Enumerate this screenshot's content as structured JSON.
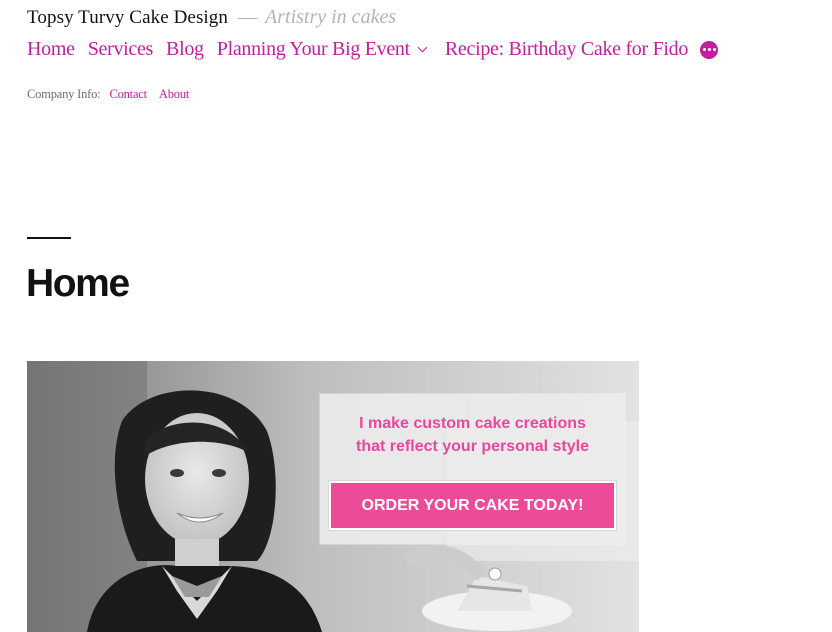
{
  "site": {
    "title": "Topsy Turvy Cake Design",
    "tagline_separator": "—",
    "tagline": "Artistry in cakes"
  },
  "main_nav": {
    "items": [
      {
        "label": "Home"
      },
      {
        "label": "Services"
      },
      {
        "label": "Blog"
      },
      {
        "label": "Planning Your Big Event",
        "has_submenu": true
      },
      {
        "label": "Recipe: Birthday Cake for Fido"
      }
    ],
    "more_icon": "more-dots-icon"
  },
  "secondary_nav": {
    "label": "Company Info:",
    "links": [
      {
        "label": "Contact"
      },
      {
        "label": "About"
      }
    ]
  },
  "page": {
    "title": "Home"
  },
  "hero": {
    "line1": "I make custom cake creations",
    "line2": "that reflect your personal style",
    "button_label": "ORDER YOUR CAKE TODAY!"
  },
  "colors": {
    "accent": "#c01f9d",
    "hero_text": "#e8479d",
    "hero_button": "#ec4b98",
    "tagline": "#b3b3b3"
  }
}
